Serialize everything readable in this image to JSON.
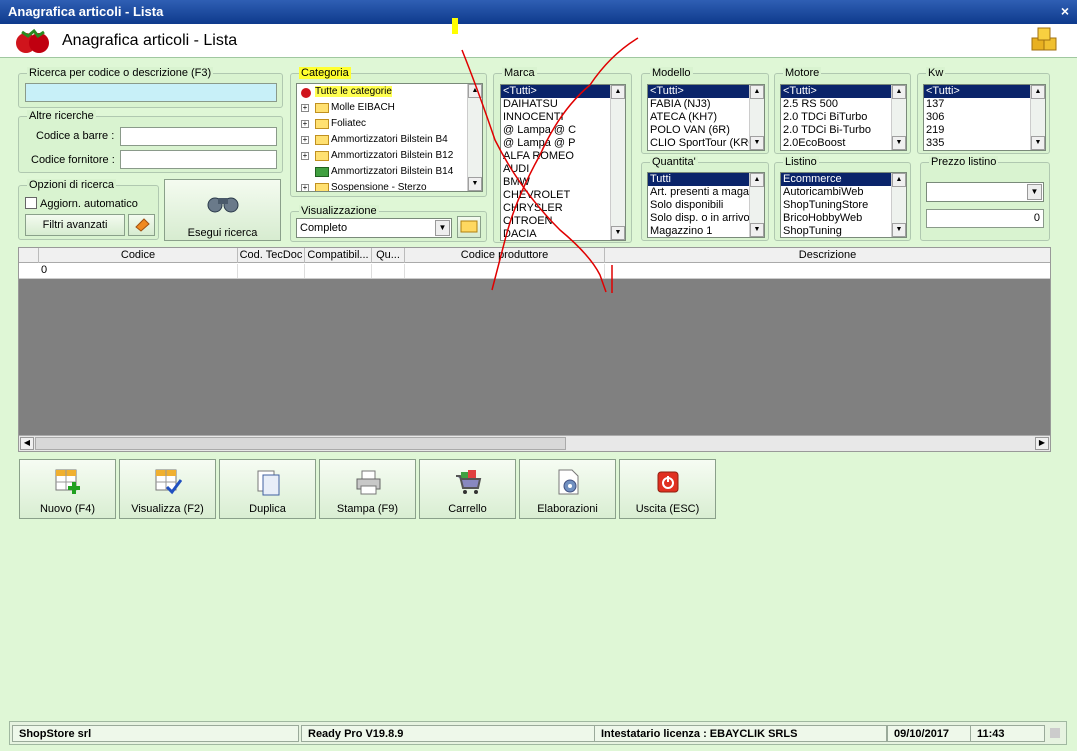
{
  "window": {
    "title": "Anagrafica articoli  - Lista",
    "close": "×"
  },
  "header": {
    "title": "Anagrafica articoli  - Lista"
  },
  "search": {
    "group_title": "Ricerca per codice o descrizione (F3)",
    "value": "",
    "other_title": "Altre ricerche",
    "barcode_label": "Codice a barre :",
    "supplier_code_label": "Codice fornitore :",
    "options_title": "Opzioni di ricerca",
    "auto_update_label": "Aggiorn. automatico",
    "advanced_filters": "Filtri avanzati",
    "run_search": "Esegui ricerca"
  },
  "categoria": {
    "title": "Categoria",
    "items": [
      "Tutte le categorie",
      "Molle EIBACH",
      "Foliatec",
      "Ammortizzatori Bilstein B4",
      "Ammortizzatori Bilstein B12",
      "Ammortizzatori Bilstein B14",
      "Sospensione - Sterzo"
    ]
  },
  "visualizzazione": {
    "title": "Visualizzazione",
    "value": "Completo"
  },
  "marca": {
    "title": "Marca",
    "items": [
      "<Tutti>",
      "DAIHATSU",
      "INNOCENTI",
      "@ Lampa @ C",
      "@ Lampa @ P",
      "ALFA ROMEO",
      "AUDI",
      "BMW",
      "CHEVROLET",
      "CHRYSLER",
      "CITROEN",
      "DACIA"
    ]
  },
  "modello": {
    "title": "Modello",
    "items": [
      "<Tutti>",
      "FABIA (NJ3)",
      "ATECA (KH7)",
      "POLO VAN (6R)",
      "CLIO SportTour (KR0"
    ]
  },
  "motore": {
    "title": "Motore",
    "items": [
      "<Tutti>",
      "2.5 RS 500",
      "2.0 TDCi BiTurbo",
      "2.0 TDCi Bi-Turbo",
      "2.0EcoBoost"
    ]
  },
  "kw": {
    "title": "Kw",
    "items": [
      "<Tutti>",
      "137",
      "306",
      "219",
      "335"
    ]
  },
  "quantita": {
    "title": "Quantita'",
    "items": [
      "Tutti",
      "Art. presenti a magaz",
      "Solo disponibili",
      "Solo disp. o in arrivo",
      "Magazzino 1"
    ]
  },
  "listino": {
    "title": "Listino",
    "items": [
      "Ecommerce",
      "AutoricambiWeb",
      "ShopTuningStore",
      "BricoHobbyWeb",
      "ShopTuning"
    ]
  },
  "prezzo": {
    "title": "Prezzo listino",
    "value": "0"
  },
  "grid": {
    "columns": [
      "Codice",
      "Cod. TecDoc",
      "Compatibil...",
      "Qu...",
      "Codice produttore",
      "Descrizione"
    ],
    "row": [
      "0",
      "",
      "",
      "",
      "",
      ""
    ]
  },
  "actions": [
    {
      "label": "Nuovo (F4)",
      "icon": "new-grid-icon"
    },
    {
      "label": "Visualizza (F2)",
      "icon": "view-grid-icon"
    },
    {
      "label": "Duplica",
      "icon": "duplicate-icon"
    },
    {
      "label": "Stampa (F9)",
      "icon": "printer-icon"
    },
    {
      "label": "Carrello",
      "icon": "cart-icon"
    },
    {
      "label": "Elaborazioni",
      "icon": "processing-icon"
    },
    {
      "label": "Uscita (ESC)",
      "icon": "power-icon"
    }
  ],
  "status": {
    "company": "ShopStore srl",
    "version": "Ready Pro V19.8.9",
    "license": "Intestatario licenza : EBAYCLIK SRLS",
    "date": "09/10/2017",
    "time": "11:43"
  },
  "colors": {
    "accent": "#0a246a",
    "background": "#dff7d6",
    "highlight": "#ffff00",
    "annotation": "#e00000"
  }
}
